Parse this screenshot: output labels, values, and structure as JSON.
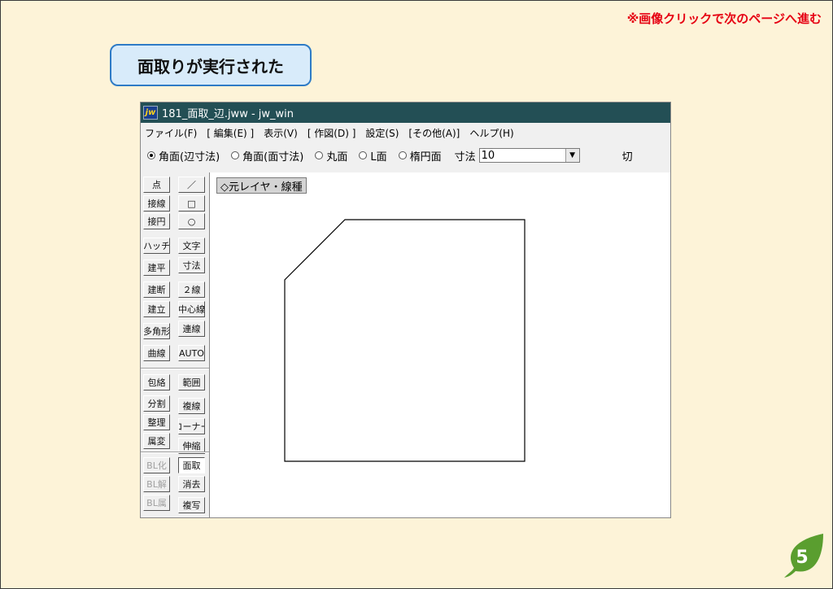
{
  "note": "※画像クリックで次のページへ進む",
  "caption": "面取りが実行された",
  "window": {
    "icon_text": "jw",
    "title": "181_面取_辺.jww - jw_win",
    "menu": [
      "ファイル(F)",
      "[ 編集(E) ]",
      "表示(V)",
      "[ 作図(D) ]",
      "設定(S)",
      "[その他(A)]",
      "ヘルプ(H)"
    ],
    "options": {
      "radios": [
        {
          "label": "角面(辺寸法)",
          "checked": true
        },
        {
          "label": "角面(面寸法)",
          "checked": false
        },
        {
          "label": "丸面",
          "checked": false
        },
        {
          "label": "L面",
          "checked": false
        },
        {
          "label": "楕円面",
          "checked": false
        }
      ],
      "dim_label": "寸法",
      "dim_value": "10",
      "cut_label": "切"
    },
    "tools_left": [
      "点",
      "接線",
      "接円",
      "ハッチ",
      "建平",
      "建断",
      "建立",
      "多角形",
      "曲線",
      "包絡",
      "分割",
      "整理",
      "属変",
      "BL化",
      "BL解",
      "BL属"
    ],
    "tools_right": [
      "／",
      "□",
      "○",
      "文字",
      "寸法",
      "２線",
      "中心線",
      "連線",
      "AUTO",
      "範囲",
      "複線",
      "コーナー",
      "伸縮",
      "面取",
      "消去",
      "複写"
    ],
    "canvas": {
      "layer_label": "◇元レイヤ・線種"
    }
  },
  "page_number": "5",
  "colors": {
    "note": "#e60012",
    "caption_border": "#2e7bc6",
    "titlebar": "#234f55",
    "badge": "#5a9e2f"
  }
}
